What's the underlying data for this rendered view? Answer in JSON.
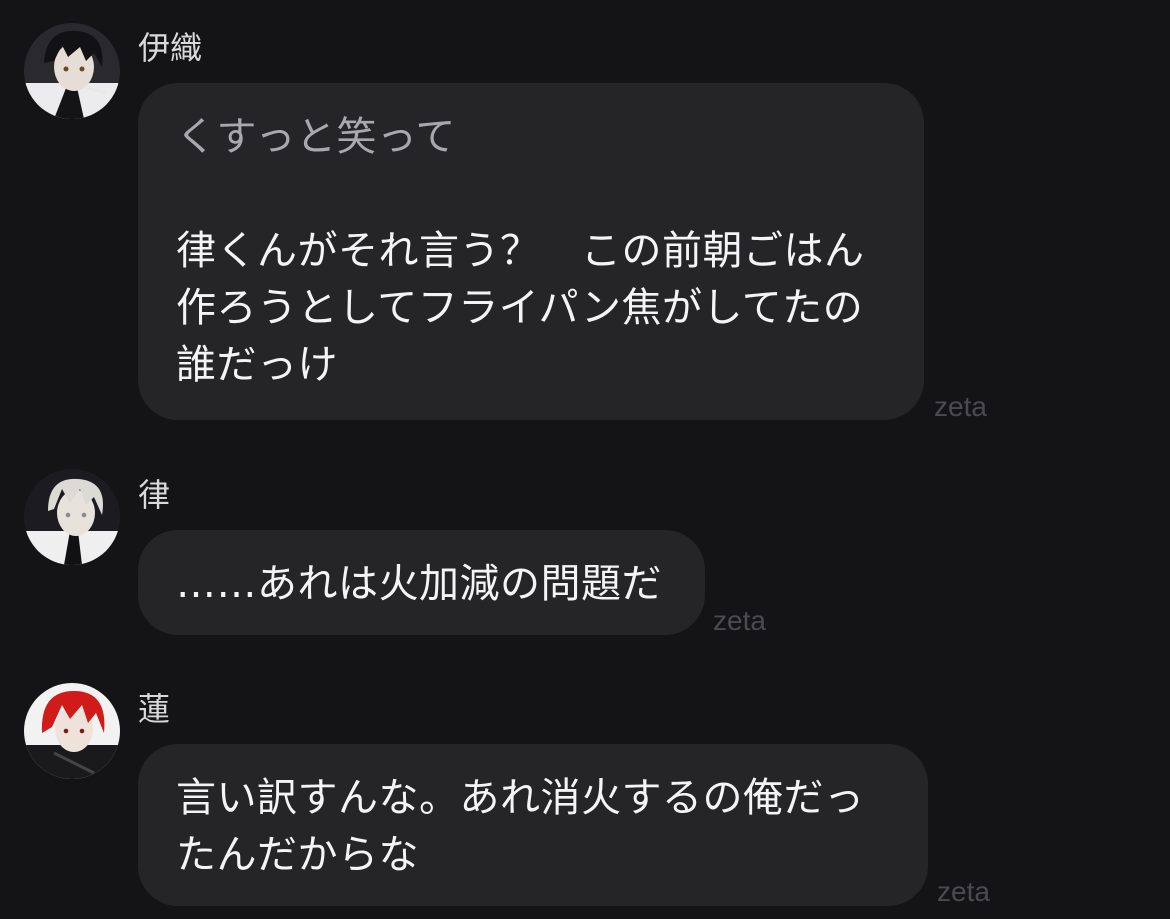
{
  "messages": [
    {
      "sender": "伊織",
      "action": "くすっと笑って",
      "lines": [
        "律くんがそれ言う？　この前朝ごはん",
        "作ろうとしてフライパン焦がしてたの",
        "誰だっけ"
      ],
      "brand": "zeta"
    },
    {
      "sender": "律",
      "lines": [
        "……あれは火加減の問題だ"
      ],
      "brand": "zeta"
    },
    {
      "sender": "蓮",
      "lines": [
        "言い訳すんな。あれ消火するの俺だっ",
        "たんだからな"
      ],
      "brand": "zeta"
    }
  ],
  "avatars": {
    "iori": {
      "hair": "#121214",
      "skin": "#e6ddd6",
      "shirt": "#ecebee"
    },
    "ritsu": {
      "hair": "#dcdad5",
      "skin": "#e8e2dc",
      "shirt": "#f0eff0"
    },
    "ren": {
      "hair": "#d11a1a",
      "skin": "#efe2da",
      "shirt": "#1a1a1c"
    }
  }
}
